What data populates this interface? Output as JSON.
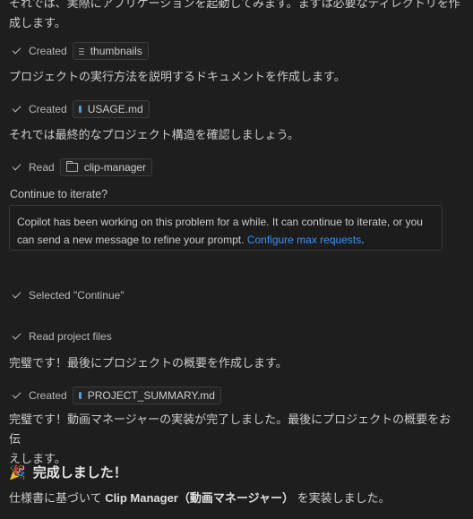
{
  "messages": {
    "top_line1": "それでは、実際にアプリケーションを起動してみます。まずは必要なディレクトリを作",
    "top_line2": "成します。",
    "p_usage": "プロジェクトの実行方法を説明するドキュメントを作成します。",
    "p_structure": "それでは最終的なプロジェクト構造を確認しましょう。",
    "p_summary": "完璧です！最後にプロジェクトの概要を作成します。",
    "p_done_line1": "完璧です！動画マネージャーの実装が完了しました。最後にプロジェクトの概要をお伝",
    "p_done_line2": "えします。",
    "heading": "完成しました！",
    "heading_icon": "party-popper-icon",
    "final_pre": "仕様書に基づいて ",
    "final_strong": "Clip Manager（動画マネージャー）",
    "final_post": " を実装しました。"
  },
  "actions": {
    "created_label": "Created",
    "read_label": "Read",
    "thumbnails": "thumbnails",
    "usage_md": "USAGE.md",
    "clip_manager": "clip-manager",
    "selected_continue": "Selected \"Continue\"",
    "read_project_files": "Read project files",
    "project_summary_md": "PROJECT_SUMMARY.md"
  },
  "iterate": {
    "label": "Continue to iterate?",
    "body": "Copilot has been working on this problem for a while. It can continue to iterate, or you can send a new message to refine your prompt. ",
    "link": "Configure max requests",
    "period": "."
  },
  "colors": {
    "background": "#1e1e1e",
    "text": "#cccccc",
    "link": "#3794ff",
    "md_icon": "#4a9ee0"
  }
}
